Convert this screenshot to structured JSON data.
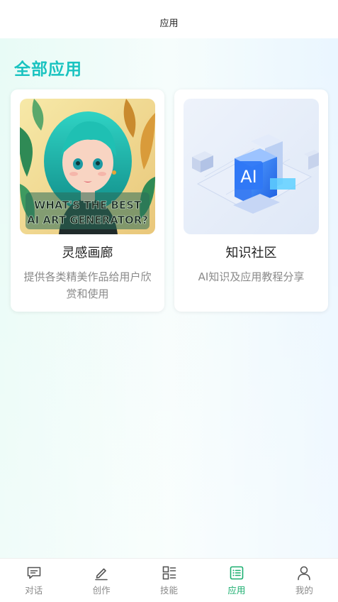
{
  "header": {
    "title": "应用"
  },
  "main": {
    "section_title": "全部应用",
    "apps": [
      {
        "name": "灵感画廊",
        "description": "提供各类精美作品给用户欣赏和使用",
        "thumb_text_line1": "WHAT'S THE BEST",
        "thumb_text_line2": "AI ART GENERATOR?"
      },
      {
        "name": "知识社区",
        "description": "AI知识及应用教程分享",
        "thumb_badge": "AI"
      }
    ]
  },
  "tabbar": {
    "active_color": "#1aae6f",
    "items": [
      {
        "label": "对话",
        "icon": "chat-icon",
        "active": false
      },
      {
        "label": "创作",
        "icon": "pen-icon",
        "active": false
      },
      {
        "label": "技能",
        "icon": "grid-list-icon",
        "active": false
      },
      {
        "label": "应用",
        "icon": "app-list-icon",
        "active": true
      },
      {
        "label": "我的",
        "icon": "user-icon",
        "active": false
      }
    ]
  }
}
